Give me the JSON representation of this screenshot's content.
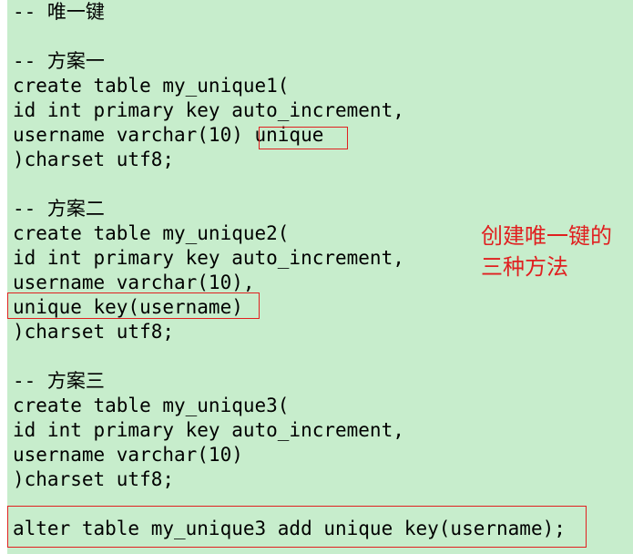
{
  "lines": [
    "-- 唯一键",
    "",
    "-- 方案一",
    "create table my_unique1(",
    "id int primary key auto_increment,",
    "username varchar(10) unique",
    ")charset utf8;",
    "",
    "-- 方案二",
    "create table my_unique2(",
    "id int primary key auto_increment,",
    "username varchar(10),",
    "unique key(username)",
    ")charset utf8;",
    "",
    "-- 方案三",
    "create table my_unique3(",
    "id int primary key auto_increment,",
    "username varchar(10)",
    ")charset utf8;",
    "",
    "alter table my_unique3 add unique key(username);"
  ],
  "annotation": {
    "line1": "创建唯一键的",
    "line2": "三种方法"
  },
  "colors": {
    "background": "#c7edcc",
    "highlight_border": "#e02020",
    "annotation_text": "#e02020"
  }
}
